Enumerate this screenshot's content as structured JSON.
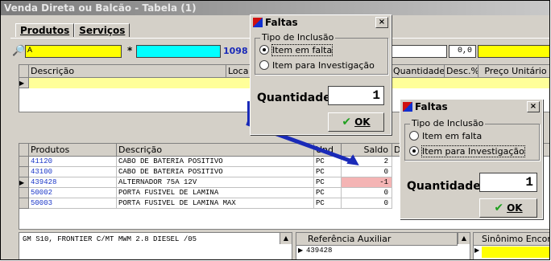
{
  "window": {
    "title": "Venda Direta ou Balcão - Tabela (1)"
  },
  "tabs": [
    {
      "label": "Produtos"
    },
    {
      "label": "Serviços"
    }
  ],
  "search": {
    "value": "A",
    "code_partial": "1098",
    "price_value": "0,0"
  },
  "top_grid": {
    "columns": [
      "Descrição",
      "Loca",
      "Quantidade",
      "Desc.%",
      "Preço Unitário"
    ]
  },
  "products": {
    "columns": [
      "Produtos",
      "Descrição",
      "Und",
      "Saldo",
      "D"
    ],
    "rows": [
      {
        "code": "41120",
        "desc": "CABO DE BATERIA POSITIVO",
        "unit": "PC",
        "saldo": "2"
      },
      {
        "code": "43100",
        "desc": "CABO DE BATERIA POSITIVO",
        "unit": "PC",
        "saldo": "0"
      },
      {
        "code": "439428",
        "desc": "ALTERNADOR 75A 12V",
        "unit": "PC",
        "saldo": "-1"
      },
      {
        "code": "50002",
        "desc": "PORTA FUSIVEL DE LAMINA",
        "unit": "PC",
        "saldo": "0"
      },
      {
        "code": "50003",
        "desc": "PORTA FUSIVEL DE LAMINA MAX",
        "unit": "PC",
        "saldo": "0"
      }
    ]
  },
  "bottom": {
    "memo": "GM S10, FRONTIER C/MT MWM 2.8 DIESEL /05",
    "ref_header": "Referência Auxiliar",
    "ref_value": "439428",
    "syn_header": "Sinônimo Encon"
  },
  "dialog1": {
    "title": "Faltas",
    "group_label": "Tipo de Inclusão",
    "opt1": "Item em falta",
    "opt2": "Item para Investigação",
    "qty_label": "Quantidade:",
    "qty_value": "1",
    "ok": "OK",
    "close": "×"
  },
  "dialog2": {
    "title": "Faltas",
    "group_label": "Tipo de Inclusão",
    "opt1": "Item em falta",
    "opt2": "Item para Investigação",
    "qty_label": "Quantidade:",
    "qty_value": "1",
    "ok": "OK",
    "close": "×"
  },
  "colors": {
    "yellow": "#ffff00",
    "cyan": "#00ffff",
    "highlight_row": "#f4b4b4",
    "arrow": "#1a2ab8",
    "code_blue": "#1a36c8"
  }
}
